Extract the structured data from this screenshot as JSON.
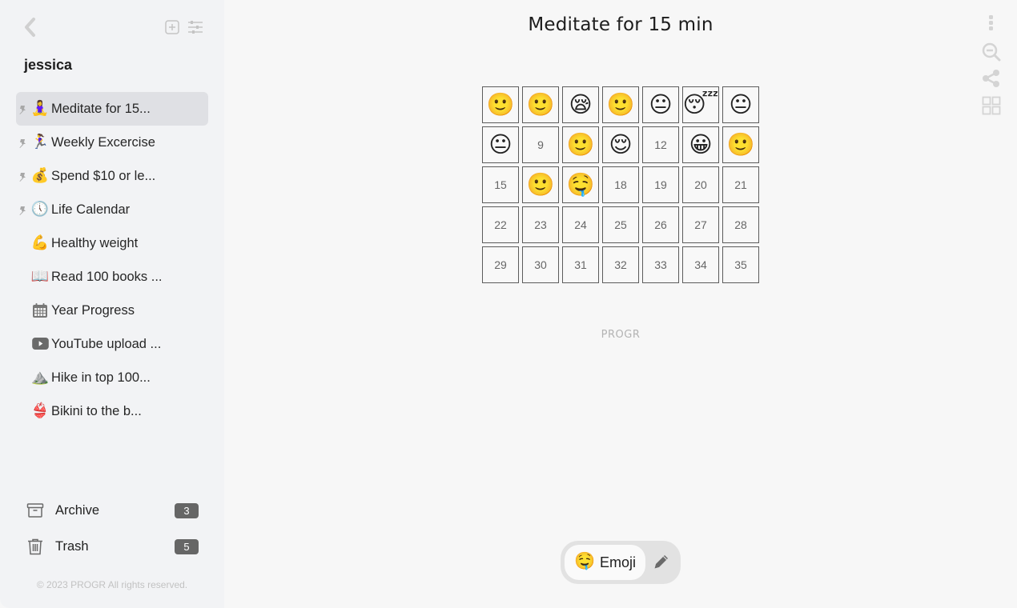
{
  "sidebar": {
    "user_name": "jessica",
    "items": [
      {
        "emoji": "🧘‍♀️",
        "label": "Meditate for 15...",
        "pinned": true,
        "active": true
      },
      {
        "emoji": "🏃‍♀️",
        "label": "Weekly Excercise",
        "pinned": true,
        "active": false
      },
      {
        "emoji": "💰",
        "label": "Spend $10 or le...",
        "pinned": true,
        "active": false
      },
      {
        "emoji": "🕔",
        "label": "Life Calendar",
        "pinned": true,
        "active": false
      },
      {
        "emoji": "💪",
        "label": "Healthy weight",
        "pinned": false,
        "active": false
      },
      {
        "emoji": "📖",
        "label": "Read 100 books ...",
        "pinned": false,
        "active": false
      },
      {
        "emoji": "calendar-icon",
        "label": "Year Progress",
        "pinned": false,
        "active": false
      },
      {
        "emoji": "youtube-icon",
        "label": "YouTube upload ...",
        "pinned": false,
        "active": false
      },
      {
        "emoji": "⛰️",
        "label": "Hike in top 100...",
        "pinned": false,
        "active": false
      },
      {
        "emoji": "👙",
        "label": "Bikini to the b...",
        "pinned": false,
        "active": false
      }
    ],
    "archive": {
      "label": "Archive",
      "count": "3"
    },
    "trash": {
      "label": "Trash",
      "count": "5"
    },
    "copyright": "© 2023 PROGR All rights reserved."
  },
  "main": {
    "title": "Meditate for 15 min",
    "brand": "PROGR",
    "cells": [
      {
        "emoji": "🙂"
      },
      {
        "emoji": "🙂"
      },
      {
        "emoji": "😪"
      },
      {
        "emoji": "🙂"
      },
      {
        "emoji": "😐"
      },
      {
        "emoji": "😴"
      },
      {
        "emoji": "😐"
      },
      {
        "emoji": "😐"
      },
      {
        "num": "9"
      },
      {
        "emoji": "🙂"
      },
      {
        "emoji": "😌"
      },
      {
        "num": "12"
      },
      {
        "emoji": "😀"
      },
      {
        "emoji": "🙂"
      },
      {
        "num": "15"
      },
      {
        "emoji": "🙂"
      },
      {
        "emoji": "🤤"
      },
      {
        "num": "18"
      },
      {
        "num": "19"
      },
      {
        "num": "20"
      },
      {
        "num": "21"
      },
      {
        "num": "22"
      },
      {
        "num": "23"
      },
      {
        "num": "24"
      },
      {
        "num": "25"
      },
      {
        "num": "26"
      },
      {
        "num": "27"
      },
      {
        "num": "28"
      },
      {
        "num": "29"
      },
      {
        "num": "30"
      },
      {
        "num": "31"
      },
      {
        "num": "32"
      },
      {
        "num": "33"
      },
      {
        "num": "34"
      },
      {
        "num": "35"
      }
    ],
    "mode": {
      "emoji": "🤤",
      "label": "Emoji"
    }
  },
  "colors": {
    "sidebar_bg": "#f2f3f5",
    "main_bg": "#f7f7f7",
    "active_item_bg": "#dfe0e4",
    "badge_bg": "#666666",
    "icon_gray": "#d4d4d4"
  }
}
